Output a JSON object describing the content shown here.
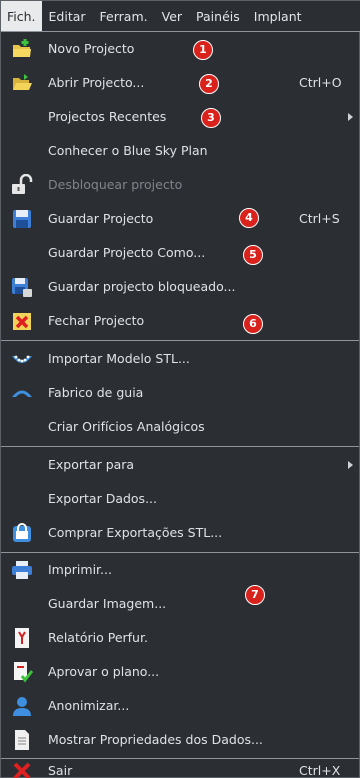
{
  "colors": {
    "background": "#2b2e33",
    "text": "#dfe2e6",
    "disabled_text": "#80858c",
    "separator": "#8e949c",
    "badge_red": "#d9221c",
    "active_menu_bg": "#e9eaec"
  },
  "menubar": {
    "items": [
      "Fich.",
      "Editar",
      "Ferram.",
      "Ver",
      "Painéis",
      "Implant"
    ]
  },
  "menu": {
    "items": [
      {
        "label": "Novo Projecto",
        "icon": "new-project-icon"
      },
      {
        "label": "Abrir Projecto...",
        "shortcut": "Ctrl+O",
        "icon": "open-folder-icon"
      },
      {
        "label": "Projectos Recentes",
        "submenu": true
      },
      {
        "label": "Conhecer o Blue Sky Plan"
      },
      {
        "label": "Desbloquear projecto",
        "disabled": true,
        "icon": "unlock-icon"
      },
      {
        "label": "Guardar Projecto",
        "shortcut": "Ctrl+S",
        "icon": "save-icon"
      },
      {
        "label": "Guardar Projecto Como..."
      },
      {
        "label": "Guardar projecto bloqueado...",
        "icon": "save-locked-icon"
      },
      {
        "label": "Fechar Projecto",
        "icon": "close-project-icon"
      },
      {
        "label": "Importar Modelo STL...",
        "icon": "import-stl-icon"
      },
      {
        "label": "Fabrico de guia",
        "icon": "surgical-guide-icon"
      },
      {
        "label": "Criar Orifícios Analógicos"
      },
      {
        "label": "Exportar para",
        "submenu": true
      },
      {
        "label": "Exportar Dados..."
      },
      {
        "label": "Comprar Exportações STL...",
        "icon": "cart-icon"
      },
      {
        "label": "Imprimir...",
        "icon": "printer-icon"
      },
      {
        "label": "Guardar Imagem..."
      },
      {
        "label": "Relatório Perfur.",
        "icon": "drill-report-icon"
      },
      {
        "label": "Aprovar o plano...",
        "icon": "approve-plan-icon"
      },
      {
        "label": "Anonimizar...",
        "icon": "anonymize-user-icon"
      },
      {
        "label": "Mostrar Propriedades dos Dados...",
        "icon": "document-icon"
      },
      {
        "label": "Sair",
        "shortcut": "Ctrl+X",
        "icon": "exit-icon"
      }
    ]
  },
  "badges": [
    "1",
    "2",
    "3",
    "4",
    "5",
    "6",
    "7"
  ]
}
